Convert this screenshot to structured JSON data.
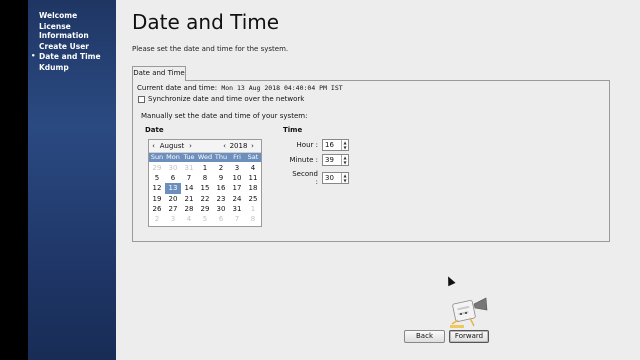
{
  "sidebar": {
    "items": [
      {
        "label": "Welcome"
      },
      {
        "label": "License Information"
      },
      {
        "label": "Create User"
      },
      {
        "label": "Date and Time"
      },
      {
        "label": "Kdump"
      }
    ]
  },
  "page": {
    "title": "Date and Time",
    "subtitle": "Please set the date and time for the system."
  },
  "tab": {
    "label": "Date and Time"
  },
  "panel": {
    "current_label": "Current date and time:",
    "current_value": "Mon 13 Aug 2018 04:40:04 PM IST",
    "sync_label": "Synchronize date and time over the network",
    "sync_checked": false,
    "manual_label": "Manually set the date and time of your system:",
    "date_heading": "Date",
    "time_heading": "Time"
  },
  "calendar": {
    "month": "August",
    "year": "2018",
    "weekdays": [
      "Sun",
      "Mon",
      "Tue",
      "Wed",
      "Thu",
      "Fri",
      "Sat"
    ],
    "days": [
      {
        "d": "29",
        "other": true
      },
      {
        "d": "30",
        "other": true
      },
      {
        "d": "31",
        "other": true
      },
      {
        "d": "1"
      },
      {
        "d": "2"
      },
      {
        "d": "3"
      },
      {
        "d": "4"
      },
      {
        "d": "5"
      },
      {
        "d": "6"
      },
      {
        "d": "7"
      },
      {
        "d": "8"
      },
      {
        "d": "9"
      },
      {
        "d": "10"
      },
      {
        "d": "11"
      },
      {
        "d": "12"
      },
      {
        "d": "13",
        "selected": true
      },
      {
        "d": "14"
      },
      {
        "d": "15"
      },
      {
        "d": "16"
      },
      {
        "d": "17"
      },
      {
        "d": "18"
      },
      {
        "d": "19"
      },
      {
        "d": "20"
      },
      {
        "d": "21"
      },
      {
        "d": "22"
      },
      {
        "d": "23"
      },
      {
        "d": "24"
      },
      {
        "d": "25"
      },
      {
        "d": "26"
      },
      {
        "d": "27"
      },
      {
        "d": "28"
      },
      {
        "d": "29"
      },
      {
        "d": "30"
      },
      {
        "d": "31"
      },
      {
        "d": "1",
        "other": true
      },
      {
        "d": "2",
        "other": true
      },
      {
        "d": "3",
        "other": true
      },
      {
        "d": "4",
        "other": true
      },
      {
        "d": "5",
        "other": true
      },
      {
        "d": "6",
        "other": true
      },
      {
        "d": "7",
        "other": true
      },
      {
        "d": "8",
        "other": true
      }
    ]
  },
  "time": {
    "hour_label": "Hour :",
    "hour": "16",
    "minute_label": "Minute :",
    "minute": "39",
    "second_label": "Second :",
    "second": "30"
  },
  "buttons": {
    "back": "Back",
    "forward": "Forward"
  },
  "colors": {
    "sidebar": "#2b4a82",
    "calendar_accent": "#6d8fbd"
  }
}
